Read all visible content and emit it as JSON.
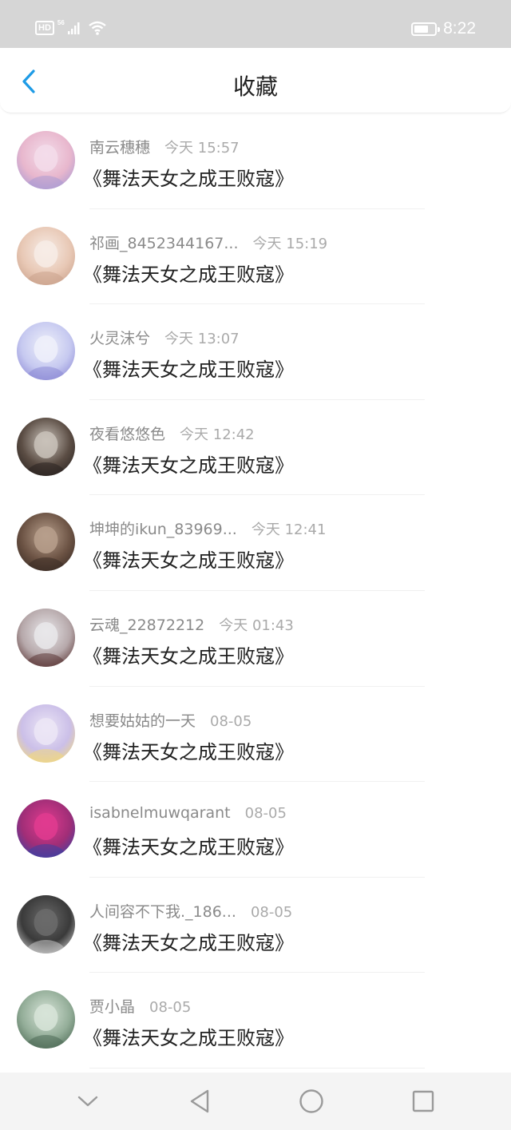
{
  "status_bar": {
    "hd": "HD",
    "network": "56",
    "time": "8:22",
    "battery_level": 0.7
  },
  "header": {
    "title": "收藏",
    "back_icon": "chevron-left-icon"
  },
  "items": [
    {
      "user": "南云穗穗",
      "time": "今天 15:57",
      "title": "《舞法天女之成王败寇》",
      "colors": [
        "#f3dcea",
        "#e8b7cd",
        "#a99ad4"
      ]
    },
    {
      "user": "祁画_8452344167...",
      "time": "今天 15:19",
      "title": "《舞法天女之成王败寇》",
      "colors": [
        "#f7ece6",
        "#e8c8b5",
        "#caa28c"
      ]
    },
    {
      "user": "火灵沫兮",
      "time": "今天 13:07",
      "title": "《舞法天女之成王败寇》",
      "colors": [
        "#eef0fa",
        "#c6c9f0",
        "#8d8ad6"
      ]
    },
    {
      "user": "夜看悠悠色",
      "time": "今天 12:42",
      "title": "《舞法天女之成王败寇》",
      "colors": [
        "#c9c2ba",
        "#5b4d44",
        "#2a2320"
      ]
    },
    {
      "user": "坤坤的ikun_83969...",
      "time": "今天 12:41",
      "title": "《舞法天女之成王败寇》",
      "colors": [
        "#b79f8c",
        "#6c5344",
        "#3a2b24"
      ]
    },
    {
      "user": "云魂_22872212",
      "time": "今天 01:43",
      "title": "《舞法天女之成王败寇》",
      "colors": [
        "#e9e7ea",
        "#b6a8aa",
        "#5b3636"
      ]
    },
    {
      "user": "想要姑姑的一天",
      "time": "08-05",
      "title": "《舞法天女之成王败寇》",
      "colors": [
        "#ece6f6",
        "#cbbfe8",
        "#f2d97c"
      ]
    },
    {
      "user": "isabnelmuwqarant",
      "time": "08-05",
      "title": "《舞法天女之成王败寇》",
      "colors": [
        "#e13b8f",
        "#a02e77",
        "#3c3fa3"
      ]
    },
    {
      "user": "人间容不下我._186...",
      "time": "08-05",
      "title": "《舞法天女之成王败寇》",
      "colors": [
        "#6b6b6b",
        "#3a3a3a",
        "#c8c8c8"
      ]
    },
    {
      "user": "贾小晶",
      "time": "08-05",
      "title": "《舞法天女之成王败寇》",
      "colors": [
        "#d7e4d8",
        "#93ad98",
        "#4d6a55"
      ]
    }
  ],
  "bottom_nav": [
    {
      "name": "collapse",
      "icon": "chevron-down-icon"
    },
    {
      "name": "back",
      "icon": "triangle-back-icon"
    },
    {
      "name": "home",
      "icon": "circle-home-icon"
    },
    {
      "name": "recents",
      "icon": "square-recents-icon"
    }
  ]
}
